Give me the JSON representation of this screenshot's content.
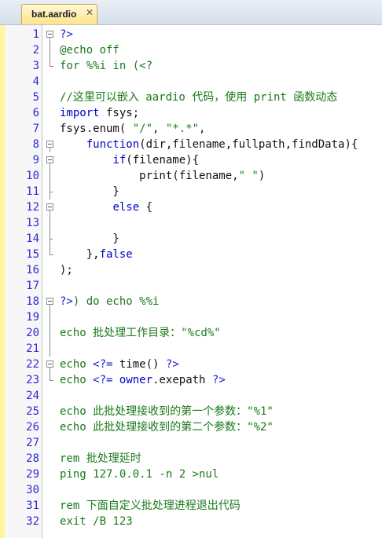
{
  "tab": {
    "title": "bat.aardio",
    "close_glyph": "✕"
  },
  "lines": [
    {
      "n": "1",
      "fold": "open",
      "segs": [
        {
          "c": "b",
          "t": "?>"
        }
      ]
    },
    {
      "n": "2",
      "fold": "line",
      "segs": [
        {
          "c": "g",
          "t": "@echo off"
        }
      ]
    },
    {
      "n": "3",
      "fold": "end",
      "segs": [
        {
          "c": "g",
          "t": "for %%i in (<?"
        }
      ]
    },
    {
      "n": "4",
      "fold": "",
      "segs": []
    },
    {
      "n": "5",
      "fold": "",
      "segs": [
        {
          "c": "g",
          "t": "//这里可以嵌入 aardio 代码，使用 print 函数动态"
        }
      ]
    },
    {
      "n": "6",
      "fold": "",
      "segs": [
        {
          "c": "k",
          "t": "import"
        },
        {
          "c": "d",
          "t": " fsys;"
        }
      ]
    },
    {
      "n": "7",
      "fold": "",
      "segs": [
        {
          "c": "d",
          "t": "fsys.enum( "
        },
        {
          "c": "g",
          "t": "\"/\""
        },
        {
          "c": "d",
          "t": ", "
        },
        {
          "c": "g",
          "t": "\"*.*\""
        },
        {
          "c": "d",
          "t": ","
        }
      ]
    },
    {
      "n": "8",
      "fold": "open",
      "segs": [
        {
          "c": "d",
          "t": "    "
        },
        {
          "c": "k",
          "t": "function"
        },
        {
          "c": "d",
          "t": "(dir,filename,fullpath,findData){"
        }
      ]
    },
    {
      "n": "9",
      "fold": "open",
      "segs": [
        {
          "c": "d",
          "t": "        "
        },
        {
          "c": "k",
          "t": "if"
        },
        {
          "c": "d",
          "t": "(filename){"
        }
      ]
    },
    {
      "n": "10",
      "fold": "line",
      "segs": [
        {
          "c": "d",
          "t": "            print(filename,"
        },
        {
          "c": "g",
          "t": "\" \""
        },
        {
          "c": "d",
          "t": ")"
        }
      ]
    },
    {
      "n": "11",
      "fold": "tick",
      "segs": [
        {
          "c": "d",
          "t": "        }"
        }
      ]
    },
    {
      "n": "12",
      "fold": "open",
      "segs": [
        {
          "c": "d",
          "t": "        "
        },
        {
          "c": "k",
          "t": "else"
        },
        {
          "c": "d",
          "t": " {"
        }
      ]
    },
    {
      "n": "13",
      "fold": "line",
      "segs": []
    },
    {
      "n": "14",
      "fold": "tick",
      "segs": [
        {
          "c": "d",
          "t": "        }"
        }
      ]
    },
    {
      "n": "15",
      "fold": "end",
      "segs": [
        {
          "c": "d",
          "t": "    },"
        },
        {
          "c": "k",
          "t": "false"
        }
      ]
    },
    {
      "n": "16",
      "fold": "",
      "segs": [
        {
          "c": "d",
          "t": ");"
        }
      ]
    },
    {
      "n": "17",
      "fold": "",
      "segs": []
    },
    {
      "n": "18",
      "fold": "open",
      "segs": [
        {
          "c": "b",
          "t": "?>"
        },
        {
          "c": "g",
          "t": ") do echo %%i"
        }
      ]
    },
    {
      "n": "19",
      "fold": "line",
      "segs": []
    },
    {
      "n": "20",
      "fold": "line",
      "segs": [
        {
          "c": "g",
          "t": "echo 批处理工作目录：\"%cd%\""
        }
      ]
    },
    {
      "n": "21",
      "fold": "line",
      "segs": []
    },
    {
      "n": "22",
      "fold": "open",
      "segs": [
        {
          "c": "g",
          "t": "echo "
        },
        {
          "c": "b",
          "t": "<?="
        },
        {
          "c": "d",
          "t": " time() "
        },
        {
          "c": "b",
          "t": "?>"
        }
      ]
    },
    {
      "n": "23",
      "fold": "end",
      "segs": [
        {
          "c": "g",
          "t": "echo "
        },
        {
          "c": "b",
          "t": "<?="
        },
        {
          "c": "d",
          "t": " "
        },
        {
          "c": "k",
          "t": "owner"
        },
        {
          "c": "d",
          "t": ".exepath "
        },
        {
          "c": "b",
          "t": "?>"
        }
      ]
    },
    {
      "n": "24",
      "fold": "",
      "segs": []
    },
    {
      "n": "25",
      "fold": "",
      "segs": [
        {
          "c": "g",
          "t": "echo 此批处理接收到的第一个参数：\"%1\""
        }
      ]
    },
    {
      "n": "26",
      "fold": "",
      "segs": [
        {
          "c": "g",
          "t": "echo 此批处理接收到的第二个参数：\"%2\""
        }
      ]
    },
    {
      "n": "27",
      "fold": "",
      "segs": []
    },
    {
      "n": "28",
      "fold": "",
      "segs": [
        {
          "c": "g",
          "t": "rem 批处理延时"
        }
      ]
    },
    {
      "n": "29",
      "fold": "",
      "segs": [
        {
          "c": "g",
          "t": "ping 127.0.0.1 -n 2 >nul"
        }
      ]
    },
    {
      "n": "30",
      "fold": "",
      "segs": []
    },
    {
      "n": "31",
      "fold": "",
      "segs": [
        {
          "c": "g",
          "t": "rem 下面自定义批处理进程退出代码"
        }
      ]
    },
    {
      "n": "32",
      "fold": "",
      "segs": [
        {
          "c": "g",
          "t": "exit /B 123"
        }
      ]
    }
  ]
}
